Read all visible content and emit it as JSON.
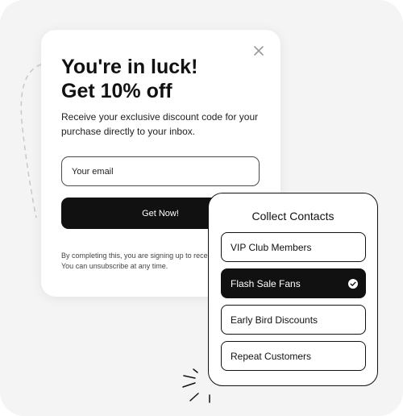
{
  "popup": {
    "headline_line1": "You're in luck!",
    "headline_line2": "Get 10% off",
    "description": "Receive your exclusive discount code for your purchase directly to your inbox.",
    "email_placeholder": "Your email",
    "submit_label": "Get Now!",
    "disclaimer_line1": "By completing this, you are signing up to receive",
    "disclaimer_line2": "You can unsubscribe at any time."
  },
  "contacts": {
    "title": "Collect Contacts",
    "options": [
      {
        "label": "VIP Club Members",
        "selected": false
      },
      {
        "label": "Flash Sale Fans",
        "selected": true
      },
      {
        "label": "Early Bird Discounts",
        "selected": false
      },
      {
        "label": "Repeat Customers",
        "selected": false
      }
    ]
  },
  "icons": {
    "close": "close-icon",
    "check": "check-circle-icon",
    "sparkle": "sparkle-decoration"
  },
  "colors": {
    "background": "#f4f4f4",
    "card": "#ffffff",
    "primary": "#111111",
    "on_primary": "#ffffff"
  }
}
